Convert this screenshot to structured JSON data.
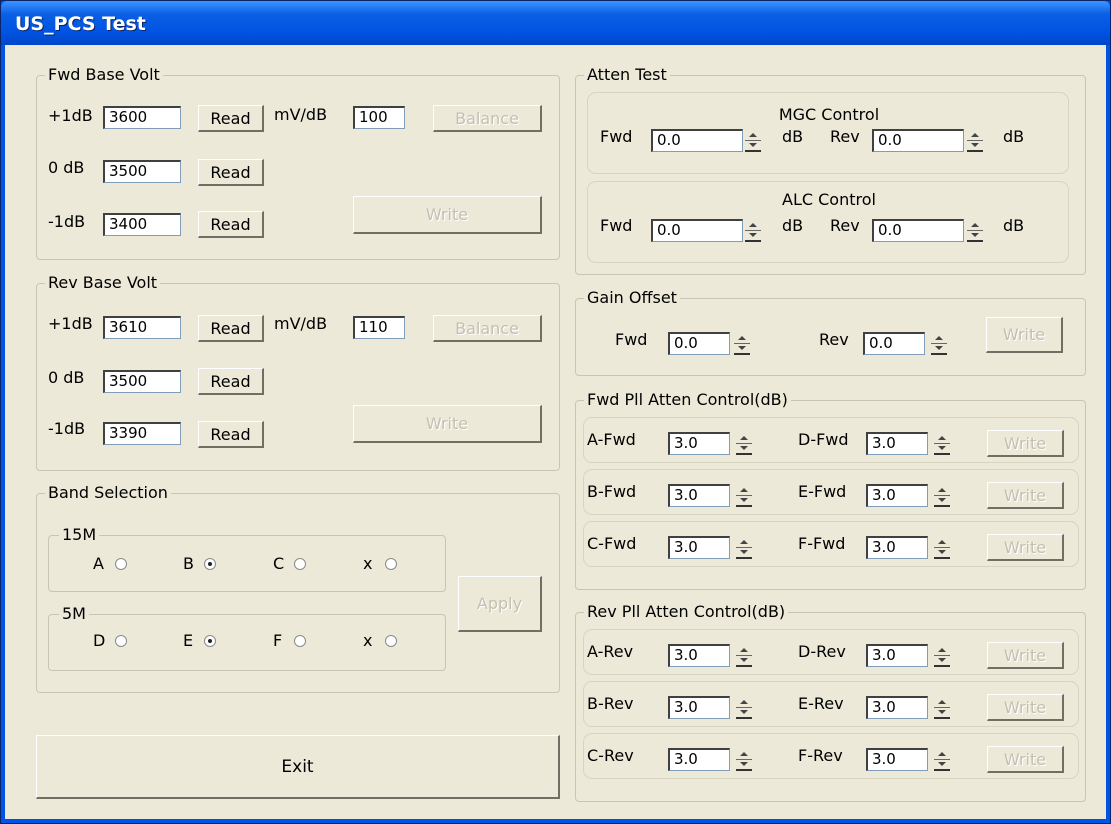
{
  "window": {
    "title": "US_PCS Test"
  },
  "fwd_base_volt": {
    "title": "Fwd Base Volt",
    "rows": [
      {
        "label": "+1dB",
        "value": "3600",
        "read": "Read"
      },
      {
        "label": "0 dB",
        "value": "3500",
        "read": "Read"
      },
      {
        "label": "-1dB",
        "value": "3400",
        "read": "Read"
      }
    ],
    "mv_label": "mV/dB",
    "mv_value": "100",
    "balance": "Balance",
    "write": "Write"
  },
  "rev_base_volt": {
    "title": "Rev Base Volt",
    "rows": [
      {
        "label": "+1dB",
        "value": "3610",
        "read": "Read"
      },
      {
        "label": "0 dB",
        "value": "3500",
        "read": "Read"
      },
      {
        "label": "-1dB",
        "value": "3390",
        "read": "Read"
      }
    ],
    "mv_label": "mV/dB",
    "mv_value": "110",
    "balance": "Balance",
    "write": "Write"
  },
  "band_selection": {
    "title": "Band Selection",
    "g15": {
      "title": "15M",
      "options": [
        {
          "label": "A",
          "checked": false
        },
        {
          "label": "B",
          "checked": true
        },
        {
          "label": "C",
          "checked": false
        },
        {
          "label": "x",
          "checked": false
        }
      ]
    },
    "g5": {
      "title": "5M",
      "options": [
        {
          "label": "D",
          "checked": false
        },
        {
          "label": "E",
          "checked": true
        },
        {
          "label": "F",
          "checked": false
        },
        {
          "label": "x",
          "checked": false
        }
      ]
    },
    "apply": "Apply"
  },
  "exit": "Exit",
  "atten_test": {
    "title": "Atten Test",
    "mgc": {
      "title": "MGC Control",
      "fwd_label": "Fwd",
      "fwd_value": "0.0",
      "rev_label": "Rev",
      "rev_value": "0.0",
      "unit": "dB"
    },
    "alc": {
      "title": "ALC Control",
      "fwd_label": "Fwd",
      "fwd_value": "0.0",
      "rev_label": "Rev",
      "rev_value": "0.0",
      "unit": "dB"
    }
  },
  "gain_offset": {
    "title": "Gain Offset",
    "fwd_label": "Fwd",
    "fwd_value": "0.0",
    "rev_label": "Rev",
    "rev_value": "0.0",
    "write": "Write"
  },
  "fwd_pll": {
    "title": "Fwd Pll Atten Control(dB)",
    "rows": [
      {
        "l1": "A-Fwd",
        "v1": "3.0",
        "l2": "D-Fwd",
        "v2": "3.0",
        "write": "Write"
      },
      {
        "l1": "B-Fwd",
        "v1": "3.0",
        "l2": "E-Fwd",
        "v2": "3.0",
        "write": "Write"
      },
      {
        "l1": "C-Fwd",
        "v1": "3.0",
        "l2": "F-Fwd",
        "v2": "3.0",
        "write": "Write"
      }
    ]
  },
  "rev_pll": {
    "title": "Rev Pll Atten Control(dB)",
    "rows": [
      {
        "l1": "A-Rev",
        "v1": "3.0",
        "l2": "D-Rev",
        "v2": "3.0",
        "write": "Write"
      },
      {
        "l1": "B-Rev",
        "v1": "3.0",
        "l2": "E-Rev",
        "v2": "3.0",
        "write": "Write"
      },
      {
        "l1": "C-Rev",
        "v1": "3.0",
        "l2": "F-Rev",
        "v2": "3.0",
        "write": "Write"
      }
    ]
  }
}
